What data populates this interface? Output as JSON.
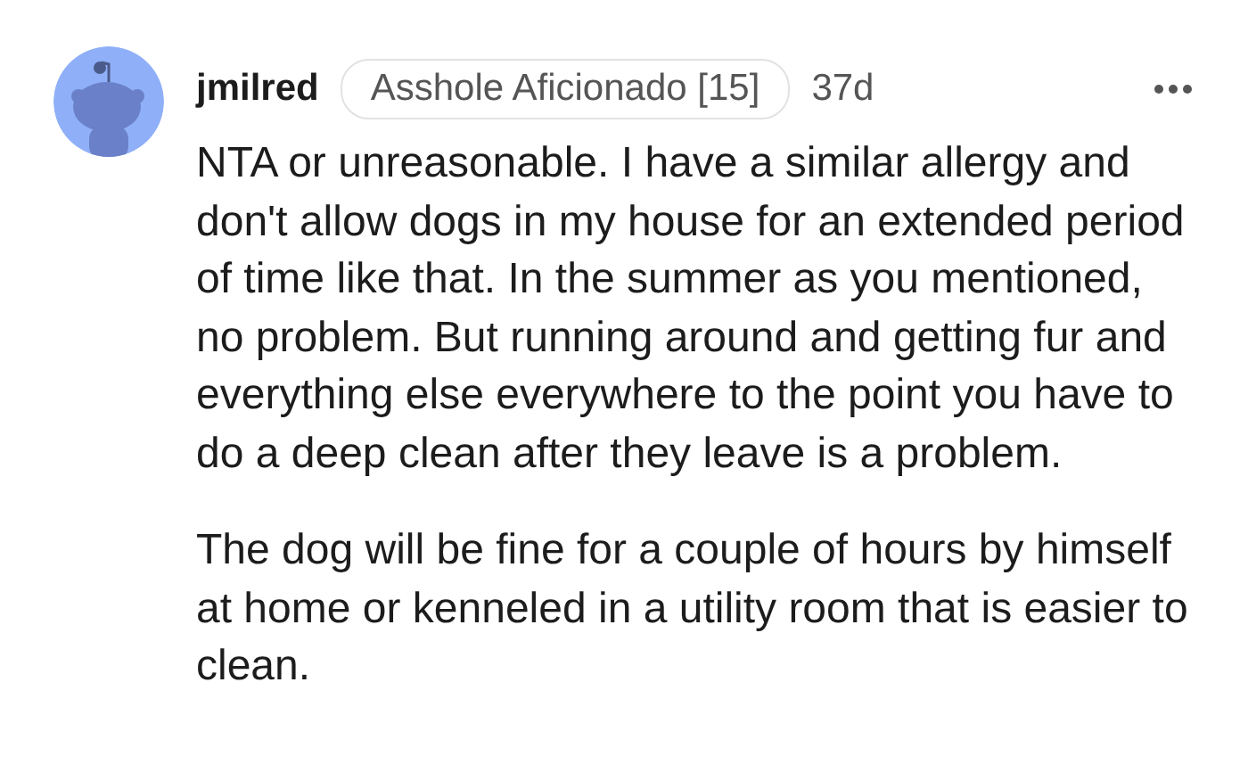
{
  "comment": {
    "username": "jmilred",
    "flair": "Asshole Aficionado [15]",
    "age": "37d",
    "paragraphs": [
      "NTA or unreasonable. I have a similar allergy and don't allow dogs in my house for an extended period of time like that. In the summer as you mentioned, no problem. But running around and getting fur and everything else everywhere to the point you have to do a deep clean after they leave is a problem.",
      "The dog will be fine for a couple of hours by himself at home or kenneled in a utility room that is easier to clean."
    ]
  }
}
